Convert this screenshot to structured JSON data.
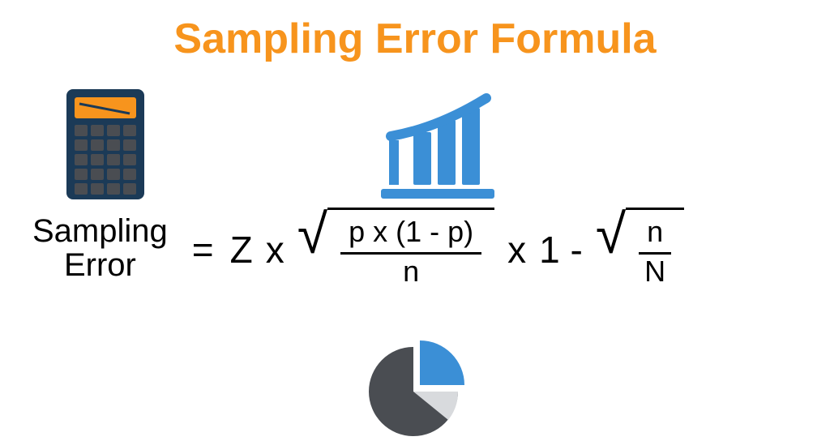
{
  "title": "Sampling Error Formula",
  "formula": {
    "lhs_line1": "Sampling",
    "lhs_line2": "Error",
    "eq": "=",
    "z": "Z",
    "mul": "x",
    "frac1_num": "p x (1 - p)",
    "frac1_den": "n",
    "one_minus": "1 -",
    "frac2_num": "n",
    "frac2_den": "N"
  },
  "colors": {
    "title": "#f7941d",
    "accent_blue": "#3b8fd6",
    "dark": "#4a4d52",
    "calc_body": "#1b3a57",
    "calc_screen": "#f7941d"
  }
}
